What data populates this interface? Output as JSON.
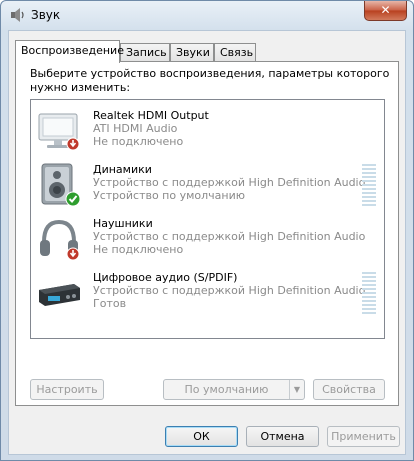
{
  "window": {
    "title": "Звук",
    "close_glyph": "✕"
  },
  "tabs": [
    {
      "label": "Воспроизведение",
      "active": true
    },
    {
      "label": "Запись",
      "active": false
    },
    {
      "label": "Звуки",
      "active": false
    },
    {
      "label": "Связь",
      "active": false
    }
  ],
  "instructions": "Выберите устройство воспроизведения, параметры которого нужно изменить:",
  "devices": [
    {
      "name": "Realtek HDMI Output",
      "line2": "ATI HDMI Audio",
      "line3": "Не подключено",
      "icon": "monitor-icon",
      "status": "disconnected",
      "meter": false
    },
    {
      "name": "Динамики",
      "line2": "Устройство с поддержкой High Definition Audio",
      "line3": "Устройство по умолчанию",
      "icon": "speaker-icon",
      "status": "default",
      "meter": true
    },
    {
      "name": "Наушники",
      "line2": "Устройство с поддержкой High Definition Audio",
      "line3": "Не подключено",
      "icon": "headphones-icon",
      "status": "disconnected",
      "meter": false
    },
    {
      "name": "Цифровое аудио (S/PDIF)",
      "line2": "Устройство с поддержкой High Definition Audio",
      "line3": "Готов",
      "icon": "digital-audio-icon",
      "status": "ready",
      "meter": true
    }
  ],
  "panel_buttons": {
    "configure": "Настроить",
    "set_default": "По умолчанию",
    "properties": "Свойства"
  },
  "dialog_buttons": {
    "ok": "ОК",
    "cancel": "Отмена",
    "apply": "Применить"
  },
  "colors": {
    "status_red": "#c0392b",
    "status_green": "#2e9e2e",
    "meter": "#c9dce8"
  }
}
